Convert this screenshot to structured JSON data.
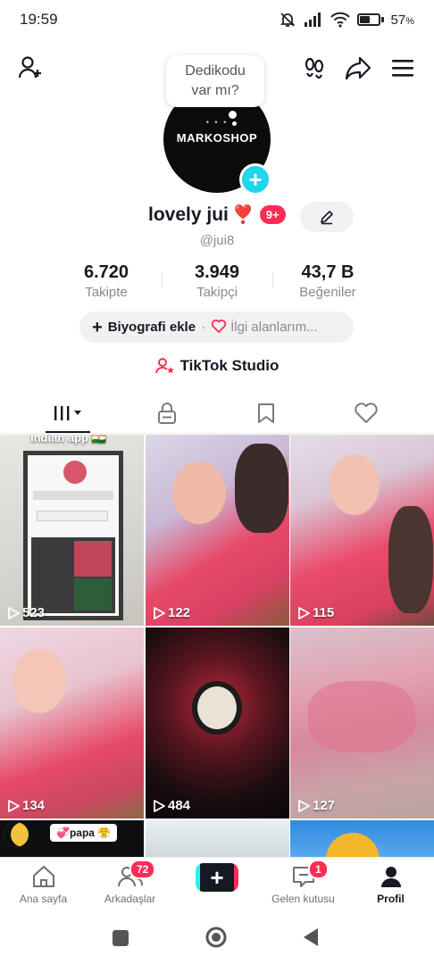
{
  "status_bar": {
    "time": "19:59",
    "battery_percent": "57",
    "battery_percent_suffix": "%",
    "battery_level": 0.57
  },
  "top_bar": {
    "icons": [
      "add-friend-icon",
      "footprints-icon",
      "share-icon",
      "menu-icon"
    ]
  },
  "note_bubble": {
    "text_line1": "Dedikodu",
    "text_line2": "var mı?"
  },
  "avatar": {
    "text": "MARKOSHOP",
    "dots": "• • •"
  },
  "profile": {
    "display_name": "lovely jui",
    "heart": "❣️",
    "notification_badge": "9+",
    "username": "@jui8"
  },
  "stats": [
    {
      "value": "6.720",
      "label": "Takipte"
    },
    {
      "value": "3.949",
      "label": "Takipçi"
    },
    {
      "value": "43,7 B",
      "label": "Beğeniler"
    }
  ],
  "bio": {
    "add_label": "Biyografi ekle",
    "separator": "·",
    "interests_label": "İlgi alanlarım..."
  },
  "studio": {
    "label": "TikTok Studio"
  },
  "tabs": [
    "videos-grid-icon",
    "lock-icon",
    "bookmark-icon",
    "heart-icon"
  ],
  "videos": [
    {
      "views": "523",
      "caption": "Indian app 🇮🇳"
    },
    {
      "views": "122"
    },
    {
      "views": "115"
    },
    {
      "views": "134"
    },
    {
      "views": "484"
    },
    {
      "views": "127"
    },
    {
      "sticker": "💞papa 😤"
    },
    {},
    {}
  ],
  "bottom_nav": {
    "home": "Ana sayfa",
    "friends": "Arkadaşlar",
    "friends_badge": "72",
    "inbox": "Gelen kutusu",
    "inbox_badge": "1",
    "profile": "Profil",
    "create": "+"
  },
  "colors": {
    "accent": "#fe2c55",
    "cyan": "#20d5ec",
    "text": "#161823",
    "muted": "#8a8b91"
  }
}
